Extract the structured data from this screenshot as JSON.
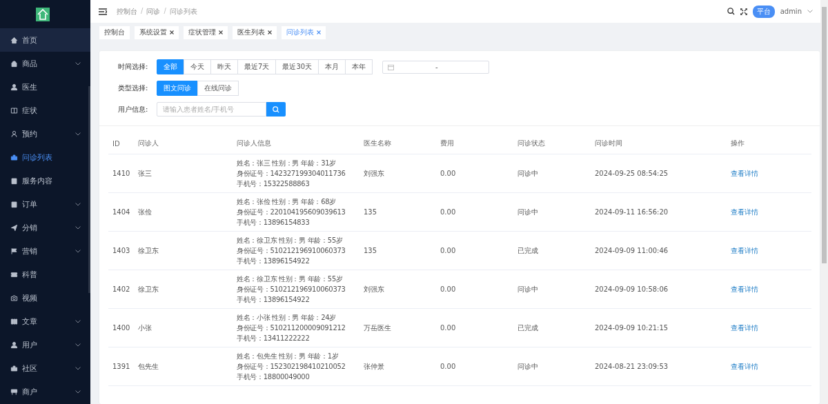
{
  "sidebar": {
    "items": [
      {
        "label": "首页",
        "expandable": false,
        "selected": false,
        "highlighted": true
      },
      {
        "label": "商品",
        "expandable": true,
        "selected": false,
        "highlighted": false
      },
      {
        "label": "医生",
        "expandable": false,
        "selected": false,
        "highlighted": false
      },
      {
        "label": "症状",
        "expandable": false,
        "selected": false,
        "highlighted": false
      },
      {
        "label": "预约",
        "expandable": true,
        "selected": false,
        "highlighted": false
      },
      {
        "label": "问诊列表",
        "expandable": false,
        "selected": true,
        "highlighted": false
      },
      {
        "label": "服务内容",
        "expandable": false,
        "selected": false,
        "highlighted": false
      },
      {
        "label": "订单",
        "expandable": true,
        "selected": false,
        "highlighted": false
      },
      {
        "label": "分销",
        "expandable": true,
        "selected": false,
        "highlighted": false
      },
      {
        "label": "营销",
        "expandable": true,
        "selected": false,
        "highlighted": false
      },
      {
        "label": "科普",
        "expandable": false,
        "selected": false,
        "highlighted": false
      },
      {
        "label": "视频",
        "expandable": false,
        "selected": false,
        "highlighted": false
      },
      {
        "label": "文章",
        "expandable": true,
        "selected": false,
        "highlighted": false
      },
      {
        "label": "用户",
        "expandable": true,
        "selected": false,
        "highlighted": false
      },
      {
        "label": "社区",
        "expandable": true,
        "selected": false,
        "highlighted": false
      },
      {
        "label": "商户",
        "expandable": true,
        "selected": false,
        "highlighted": false
      }
    ]
  },
  "header": {
    "breadcrumb": [
      "控制台",
      "问诊",
      "问诊列表"
    ],
    "breadcrumb_separator": "/",
    "role_badge": "平台",
    "user": "admin"
  },
  "tabs": [
    {
      "label": "控制台",
      "closable": false,
      "selected": false
    },
    {
      "label": "系统设置",
      "closable": true,
      "selected": false
    },
    {
      "label": "症状管理",
      "closable": true,
      "selected": false
    },
    {
      "label": "医生列表",
      "closable": true,
      "selected": false
    },
    {
      "label": "问诊列表",
      "closable": true,
      "selected": true
    }
  ],
  "filters": {
    "time": {
      "label": "时间选择:",
      "options": [
        {
          "label": "全部",
          "selected": true
        },
        {
          "label": "今天",
          "selected": false
        },
        {
          "label": "昨天",
          "selected": false
        },
        {
          "label": "最近7天",
          "selected": false
        },
        {
          "label": "最近30天",
          "selected": false
        },
        {
          "label": "本月",
          "selected": false
        },
        {
          "label": "本年",
          "selected": false
        }
      ],
      "range_separator": "-"
    },
    "type": {
      "label": "类型选择:",
      "options": [
        {
          "label": "图文问诊",
          "selected": true
        },
        {
          "label": "在线问诊",
          "selected": false
        }
      ]
    },
    "user": {
      "label": "用户信息:",
      "placeholder": "请输入患者姓名/手机号"
    }
  },
  "table": {
    "columns": [
      "ID",
      "问诊人",
      "问诊人信息",
      "医生名称",
      "费用",
      "问诊状态",
      "问诊时间",
      "操作"
    ],
    "rows": [
      {
        "id": "1410",
        "patient": "张三",
        "info": [
          "姓名：张三 性别：男 年龄：31岁",
          "身份证号：142327199304011736",
          "手机号：15322588863"
        ],
        "doctor": "刘强东",
        "fee": "0.00",
        "status": "问诊中",
        "time": "2024-09-25 08:54:25",
        "action": "查看详情"
      },
      {
        "id": "1404",
        "patient": "张俭",
        "info": [
          "姓名：张俭 性别：男 年龄：68岁",
          "身份证号：220104195609039613",
          "手机号：13896154833"
        ],
        "doctor": "135",
        "fee": "0.00",
        "status": "问诊中",
        "time": "2024-09-11 16:56:20",
        "action": "查看详情"
      },
      {
        "id": "1403",
        "patient": "徐卫东",
        "info": [
          "姓名：徐卫东 性别：男 年龄：55岁",
          "身份证号：510212196910060373",
          "手机号：13896154922"
        ],
        "doctor": "135",
        "fee": "0.00",
        "status": "已完成",
        "time": "2024-09-09 11:00:46",
        "action": "查看详情"
      },
      {
        "id": "1402",
        "patient": "徐卫东",
        "info": [
          "姓名：徐卫东 性别：男 年龄：55岁",
          "身份证号：510212196910060373",
          "手机号：13896154922"
        ],
        "doctor": "刘强东",
        "fee": "0.00",
        "status": "问诊中",
        "time": "2024-09-09 10:58:06",
        "action": "查看详情"
      },
      {
        "id": "1400",
        "patient": "小张",
        "info": [
          "姓名：小张 性别：男 年龄：24岁",
          "身份证号：510211200009091212",
          "手机号：13411222222"
        ],
        "doctor": "万岳医生",
        "fee": "0.00",
        "status": "已完成",
        "time": "2024-09-09 10:21:15",
        "action": "查看详情"
      },
      {
        "id": "1391",
        "patient": "包先生",
        "info": [
          "姓名：包先生 性别：男 年龄：1岁",
          "身份证号：152302198410210052",
          "手机号：18800049000"
        ],
        "doctor": "张仲景",
        "fee": "0.00",
        "status": "问诊中",
        "time": "2024-08-21 23:09:53",
        "action": "查看详情"
      }
    ]
  }
}
